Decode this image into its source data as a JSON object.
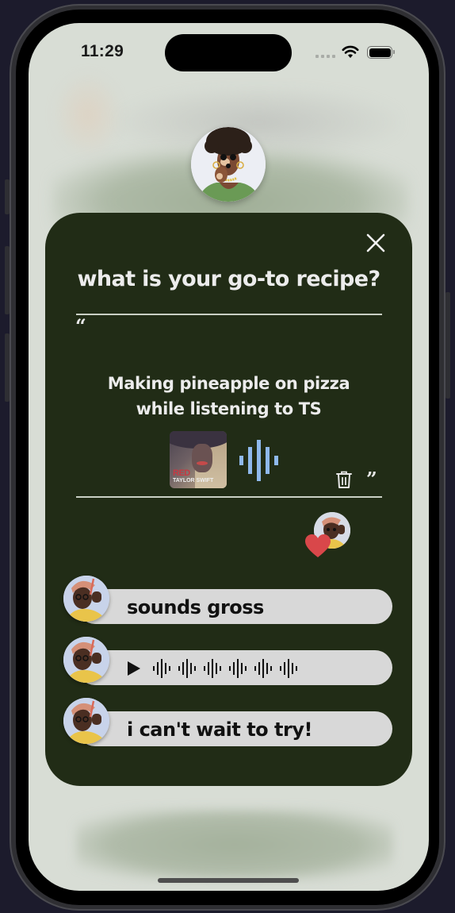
{
  "status_bar": {
    "time": "11:29",
    "wifi_icon": "wifi-icon",
    "battery_icon": "battery-icon",
    "signal_icon": "cellular-dots-icon"
  },
  "host": {
    "avatar": "memoji-avatar-woman-green-top"
  },
  "prompt_card": {
    "close_icon": "close-icon",
    "question": "what is your go-to recipe?",
    "open_quote": "“",
    "close_quote": "”",
    "answer_lines": [
      "Making pineapple on pizza",
      "while listening to TS"
    ],
    "attachment": {
      "album_title": "RED",
      "album_artist": "TAYLOR SWIFT",
      "audio_icon": "audio-waveform-icon",
      "accent_color": "#8fb9ec"
    },
    "delete_icon": "trash-icon",
    "background_color": "#212c16"
  },
  "reaction": {
    "icon": "heart-icon",
    "color": "#d9474a",
    "avatar": "memoji-avatar-raised-fist"
  },
  "comments": [
    {
      "type": "text",
      "text": "sounds gross",
      "avatar": "memoji-avatar-raised-fist"
    },
    {
      "type": "voice",
      "play_icon": "play-icon",
      "avatar": "memoji-avatar-raised-fist"
    },
    {
      "type": "text",
      "text": "i can't wait to try!",
      "avatar": "memoji-avatar-raised-fist"
    }
  ]
}
